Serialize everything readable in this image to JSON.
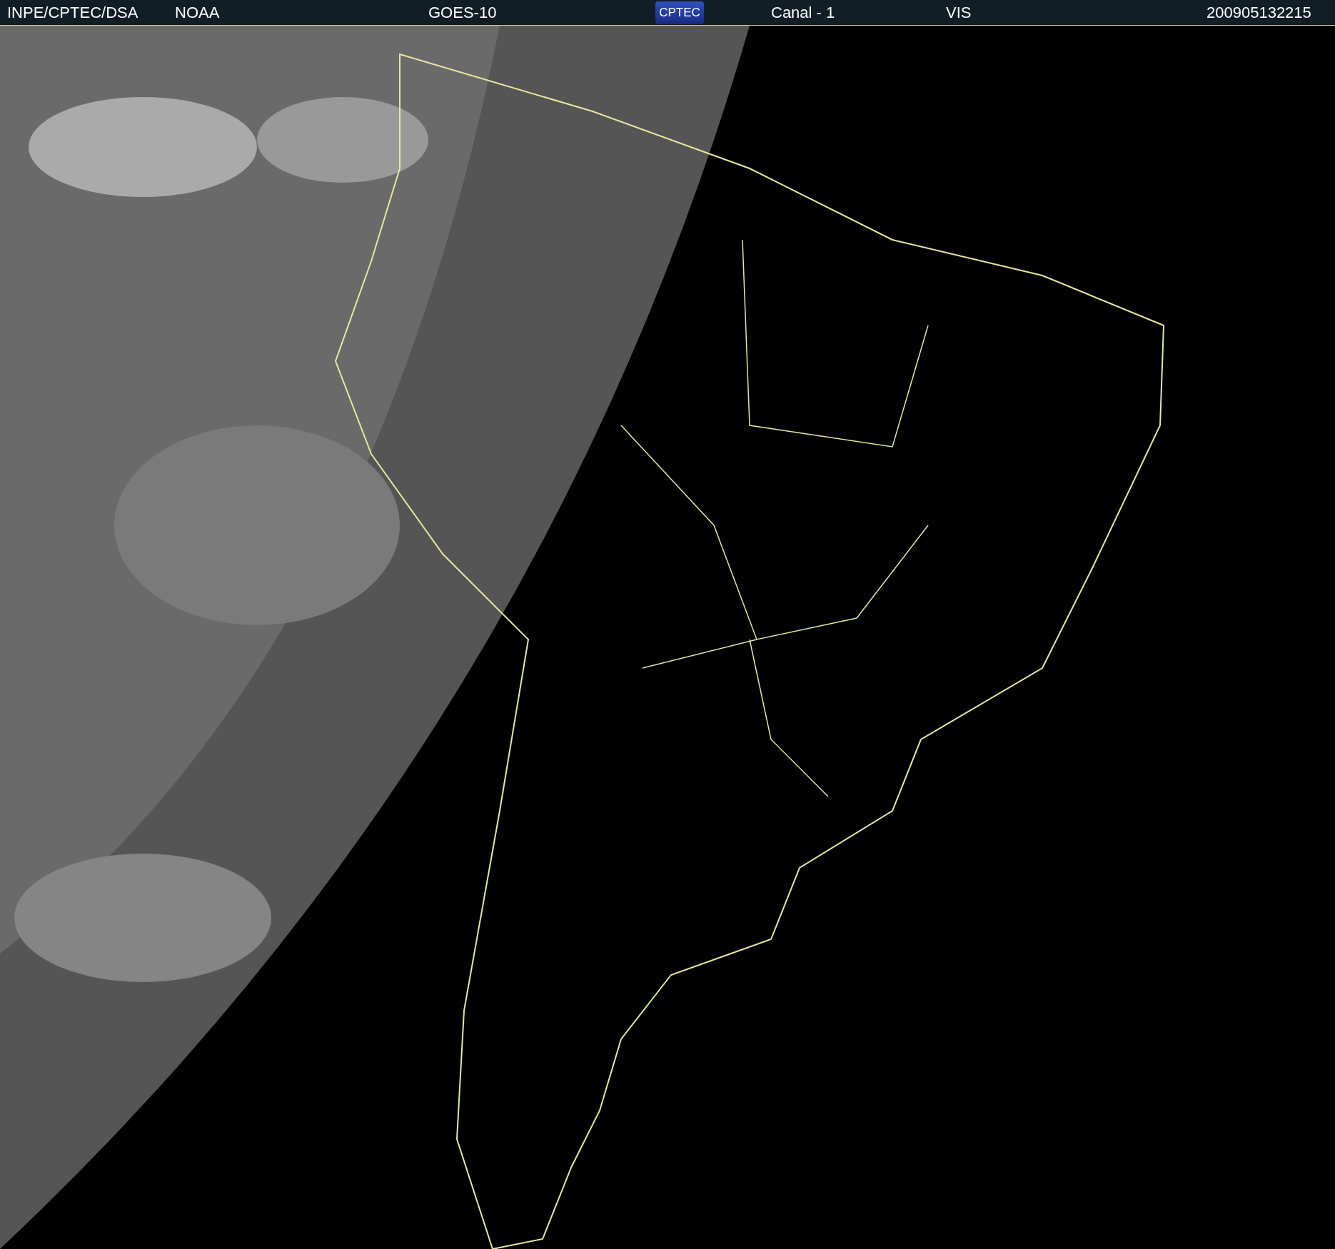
{
  "header": {
    "items": [
      {
        "kind": "text",
        "text": "INPE/CPTEC/DSA"
      },
      {
        "kind": "text",
        "text": "NOAA"
      },
      {
        "kind": "text",
        "text": "GOES-10"
      },
      {
        "kind": "logo",
        "text": "CPTEC"
      },
      {
        "kind": "text",
        "text": "Canal - 1"
      },
      {
        "kind": "text",
        "text": "VIS"
      },
      {
        "kind": "text",
        "text": "200905132215"
      }
    ]
  }
}
